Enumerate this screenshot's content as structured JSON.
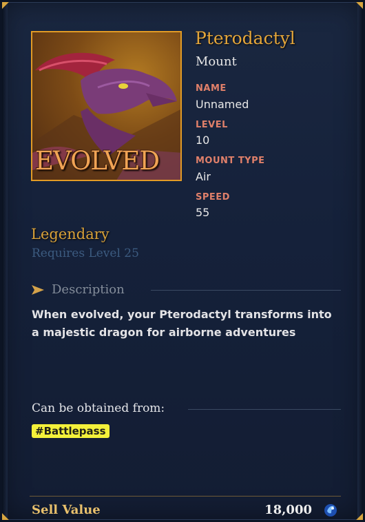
{
  "item": {
    "name": "Pterodactyl",
    "category": "Mount",
    "portrait_overlay": "EVOLVED",
    "portrait_icon": "pterodactyl-portrait",
    "rarity": "Legendary",
    "requirement": "Requires Level 25"
  },
  "stats": [
    {
      "label": "NAME",
      "value": "Unnamed"
    },
    {
      "label": "LEVEL",
      "value": "10"
    },
    {
      "label": "MOUNT TYPE",
      "value": "Air"
    },
    {
      "label": "SPEED",
      "value": "55"
    }
  ],
  "description": {
    "heading": "Description",
    "text": "When evolved, your Pterodactyl transforms into a majestic dragon for airborne adventures"
  },
  "obtain": {
    "label": "Can be obtained from:",
    "tags": [
      "#Battlepass"
    ]
  },
  "sell": {
    "label": "Sell Value",
    "value": "18,000",
    "currency_icon": "blue-gem-icon"
  },
  "colors": {
    "title_gold": "#e4a63b",
    "stat_label": "#e0806a",
    "rarity": "#d9a23a",
    "tag_bg": "#f4f13a",
    "portrait_border": "#e29b25"
  }
}
